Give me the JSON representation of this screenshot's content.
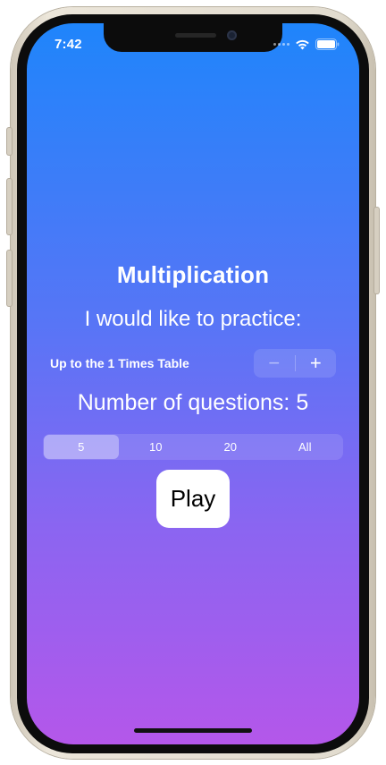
{
  "status_bar": {
    "time": "7:42",
    "signal_icon": "cellular-dots-icon",
    "wifi_icon": "wifi-icon",
    "battery_icon": "battery-icon"
  },
  "main": {
    "title": "Multiplication",
    "subtitle": "I would like to practice:",
    "stepper": {
      "label": "Up to the 1 Times Table",
      "minus_symbol": "−",
      "plus_symbol": "+"
    },
    "questions_label": "Number of questions: 5",
    "question_options": [
      "5",
      "10",
      "20",
      "All"
    ],
    "selected_option": "5",
    "play_label": "Play"
  },
  "colors": {
    "gradient_top": "#1f85fb",
    "gradient_bottom": "#b457ea",
    "text": "#ffffff",
    "play_button_bg": "#ffffff"
  }
}
